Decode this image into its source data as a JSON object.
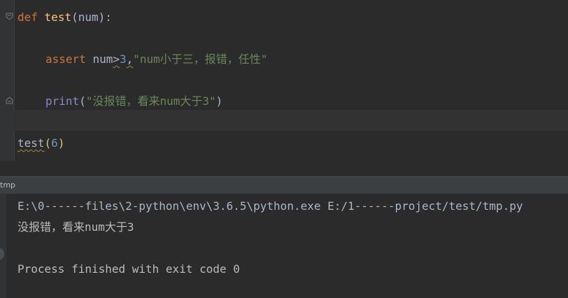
{
  "editor": {
    "line1": {
      "kw_def": "def",
      "fn_name": "test",
      "open_paren": "(",
      "param": "num",
      "close_paren": ")",
      "colon": ":"
    },
    "line2": {
      "kw_assert": "assert",
      "var": "num",
      "op": ">",
      "num": "3",
      "comma": ",",
      "msg": "\"num小于三，报错，任性\""
    },
    "line3": {
      "builtin": "print",
      "open_paren": "(",
      "msg": "\"没报错，看来num大于3\"",
      "close_paren": ")"
    },
    "line4": {
      "call": "test",
      "open_paren": "(",
      "arg": "6",
      "close_paren": ")"
    }
  },
  "run_panel": {
    "tab_label": "tmp"
  },
  "console": {
    "command": "E:\\0------files\\2-python\\env\\3.6.5\\python.exe E:/1------project/test/tmp.py",
    "output": "没报错，看来num大于3",
    "finished": "Process finished with exit code 0"
  },
  "icons": [
    "fold-open-icon",
    "fold-close-icon",
    "console-marker-icon"
  ],
  "colors": {
    "background": "#2b2b2b",
    "keyword": "#cc7832",
    "function": "#ffc66d",
    "number": "#6897bb",
    "string": "#6a8759",
    "builtin": "#8888c6",
    "text": "#a9b7c6"
  }
}
